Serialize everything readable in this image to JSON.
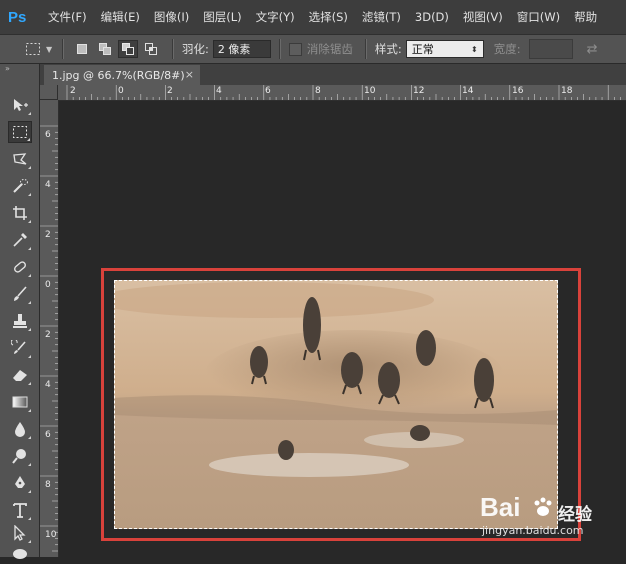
{
  "menubar": {
    "logo": "Ps",
    "items": [
      "文件(F)",
      "编辑(E)",
      "图像(I)",
      "图层(L)",
      "文字(Y)",
      "选择(S)",
      "滤镜(T)",
      "3D(D)",
      "视图(V)",
      "窗口(W)",
      "帮助"
    ]
  },
  "options": {
    "feather_label": "羽化:",
    "feather_value": "2 像素",
    "antialias_label": "消除锯齿",
    "style_label": "样式:",
    "style_value": "正常",
    "width_label": "宽度:"
  },
  "document": {
    "tab_title": "1.jpg @ 66.7%(RGB/8#)",
    "close_glyph": "×"
  },
  "rulers": {
    "horizontal": [
      "2",
      "0",
      "2",
      "4",
      "6",
      "8",
      "10",
      "12",
      "14",
      "16",
      "18"
    ],
    "vertical": [
      "6",
      "4",
      "2",
      "0",
      "2",
      "4",
      "6",
      "8",
      "10"
    ]
  },
  "watermark": {
    "logo": "Bai",
    "suffix": "经验",
    "url": "jingyan.baidu.com"
  },
  "colors": {
    "menubar": "#3d3d3d",
    "panel": "#535353",
    "canvas_bg": "#282828",
    "highlight": "#d9423b",
    "ps_blue": "#30a8ff"
  }
}
